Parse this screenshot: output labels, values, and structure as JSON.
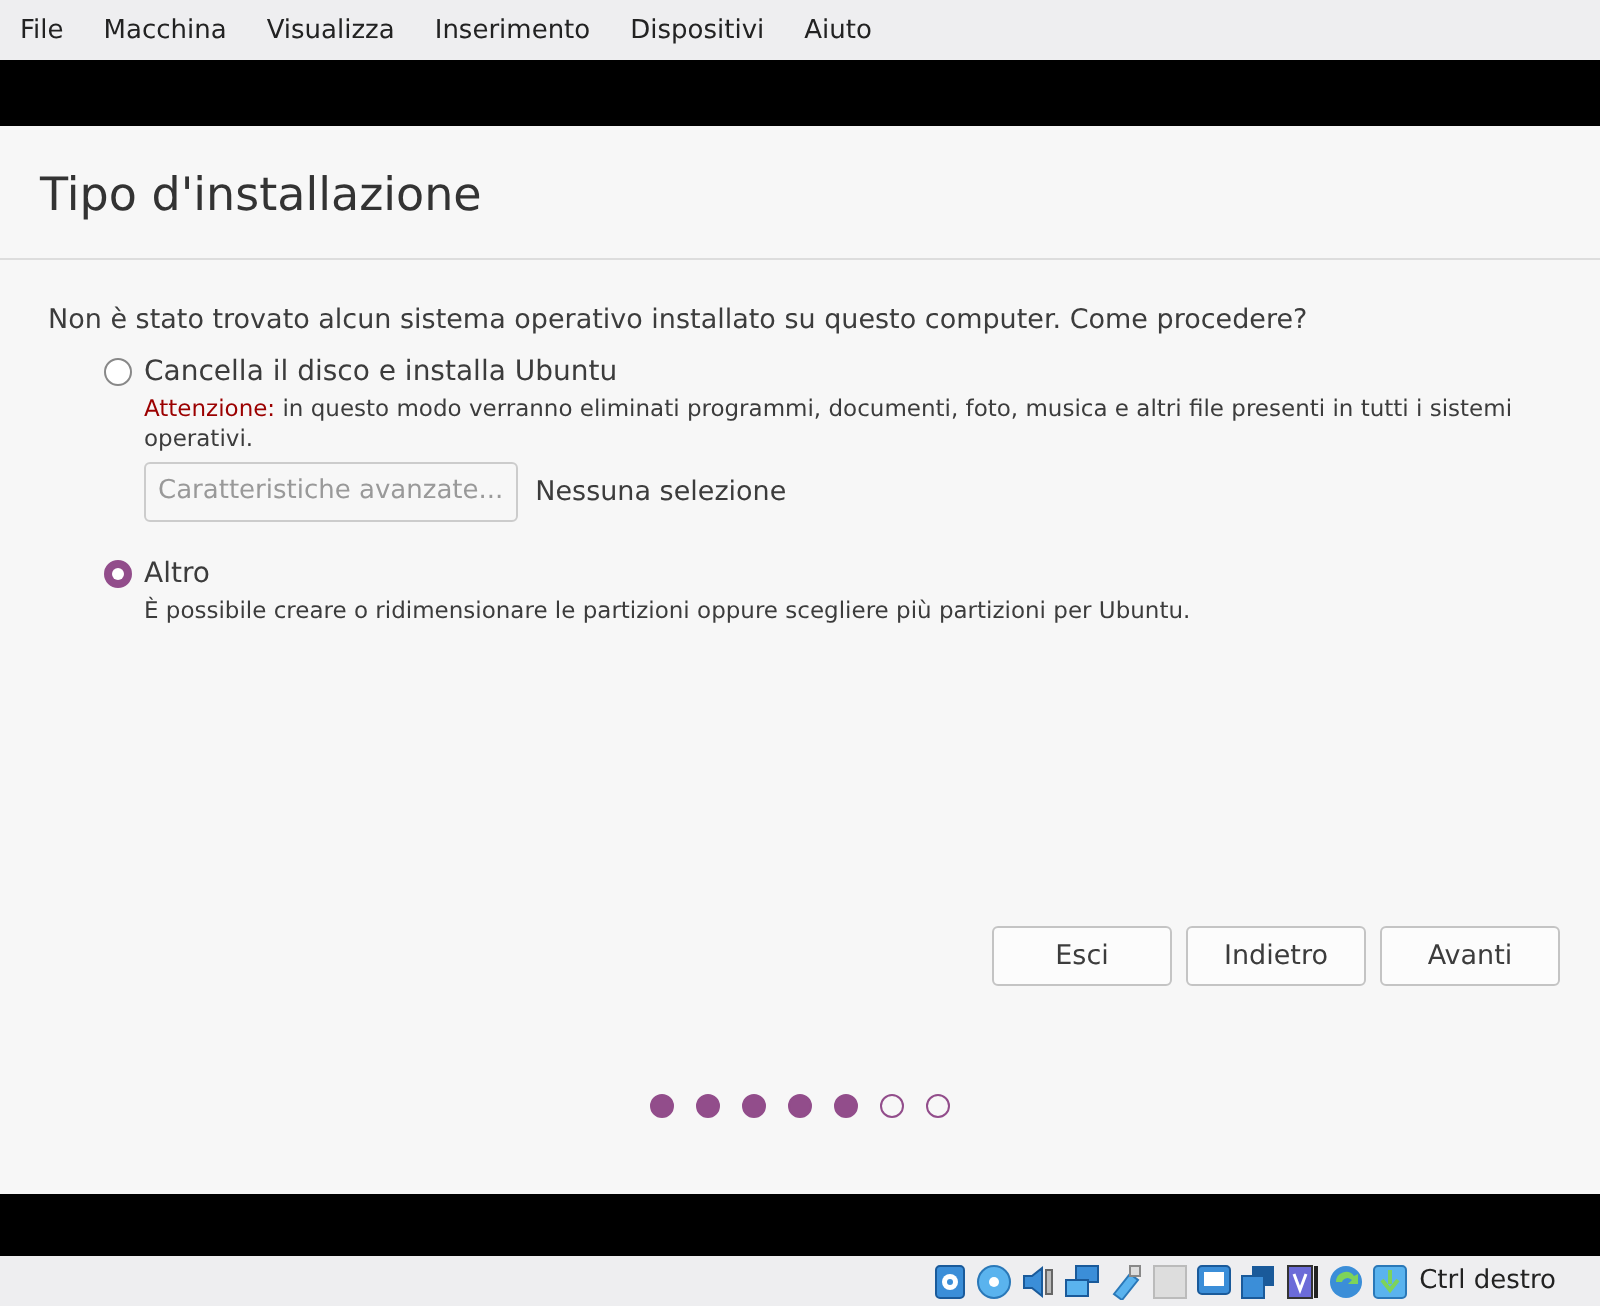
{
  "menu": [
    "File",
    "Macchina",
    "Visualizza",
    "Inserimento",
    "Dispositivi",
    "Aiuto"
  ],
  "page": {
    "title": "Tipo d'installazione",
    "question": "Non è stato trovato alcun sistema operativo installato su questo computer. Come procedere?"
  },
  "options": [
    {
      "label": "Cancella il disco e installa Ubuntu",
      "selected": false,
      "warning": {
        "label": "Attenzione:",
        "text": " in questo modo verranno eliminati programmi, documenti, foto, musica e altri file presenti in tutti i sistemi operativi."
      },
      "advanced_button": {
        "label": "Caratteristiche avanzate...",
        "disabled": true
      },
      "advanced_status": "Nessuna selezione"
    },
    {
      "label": "Altro",
      "selected": true,
      "description": "È possibile creare o ridimensionare le partizioni oppure scegliere più partizioni per Ubuntu."
    }
  ],
  "buttons": [
    "Esci",
    "Indietro",
    "Avanti"
  ],
  "progress": [
    {
      "done": true
    },
    {
      "done": true
    },
    {
      "done": true
    },
    {
      "done": true
    },
    {
      "done": true
    },
    {
      "done": false
    },
    {
      "done": false
    }
  ],
  "status_bar": {
    "host_key": "Ctrl destro"
  }
}
